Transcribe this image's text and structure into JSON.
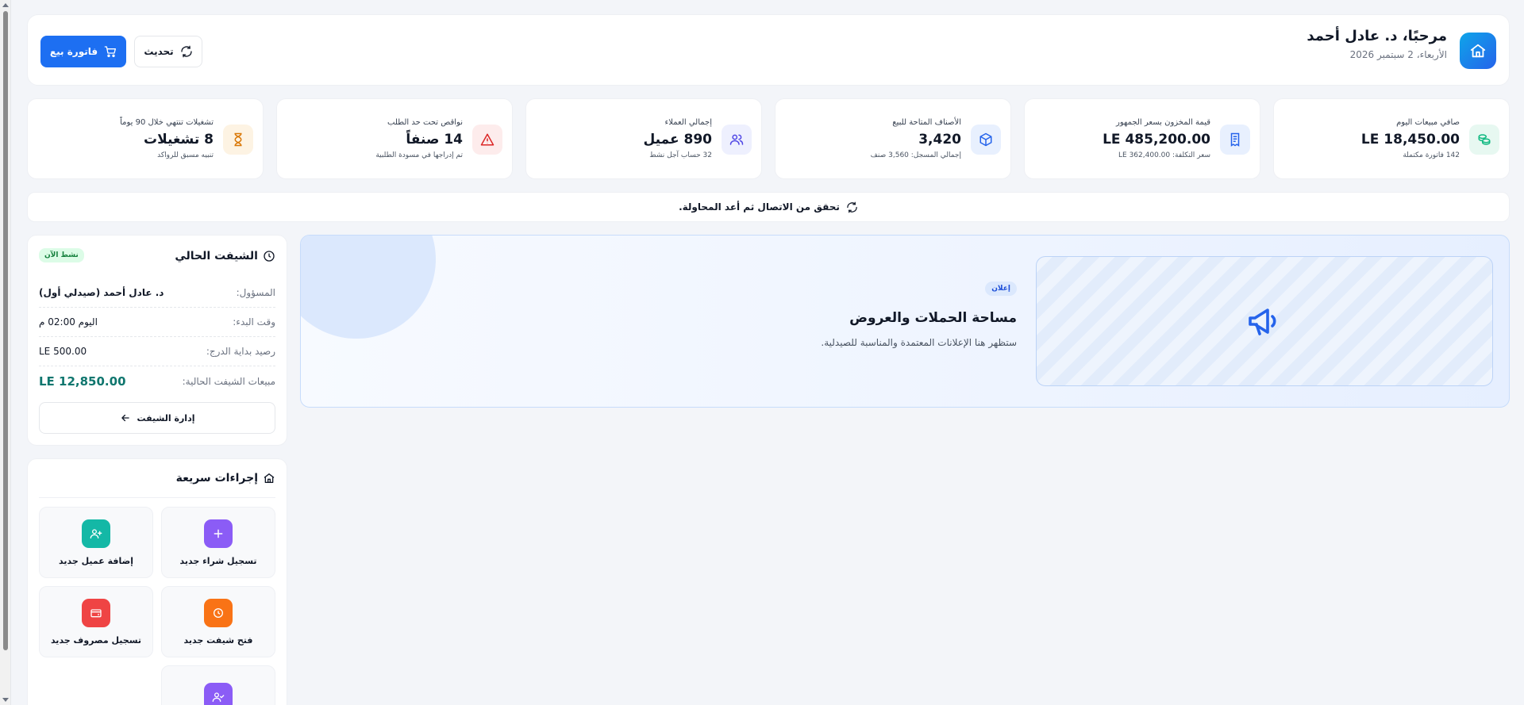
{
  "header": {
    "greeting": "مرحبًا، د. عادل أحمد",
    "date": "الأربعاء، 2 سبتمبر 2026",
    "invoice_button": "فاتورة بيع",
    "refresh_button": "تحديث"
  },
  "stats": [
    {
      "label": "صافي مبيعات اليوم",
      "value": "18,450.00 LE",
      "sub": "142 فاتورة مكتملة",
      "icon": "coins-icon",
      "color": "#10b981",
      "bg": "#e7f8f1"
    },
    {
      "label": "قيمة المخزون بسعر الجمهور",
      "value": "485,200.00 LE",
      "sub": "سعر التكلفة: 362,400.00 LE",
      "icon": "receipt-icon",
      "color": "#2563eb",
      "bg": "#e8f0fe"
    },
    {
      "label": "الأصناف المتاحة للبيع",
      "value": "3,420",
      "sub": "إجمالي المسجل: 3,560 صنف",
      "icon": "box-icon",
      "color": "#2563eb",
      "bg": "#e8f0fe"
    },
    {
      "label": "إجمالي العملاء",
      "value": "890 عميل",
      "sub": "32 حساب آجل نشط",
      "icon": "users-icon",
      "color": "#4f46e5",
      "bg": "#eef0fe"
    },
    {
      "label": "نواقص تحت حد الطلب",
      "value": "14 صنفاً",
      "sub": "تم إدراجها في مسودة الطلبية",
      "icon": "warning-icon",
      "color": "#dc2626",
      "bg": "#fdecec"
    },
    {
      "label": "تشغيلات تنتهي خلال 90 يوماً",
      "value": "8 تشغيلات",
      "sub": "تنبيه مسبق للرواكد",
      "icon": "hourglass-icon",
      "color": "#d97706",
      "bg": "#fdf3e3"
    }
  ],
  "connection": {
    "message": "تحقق من الاتصال ثم أعد المحاولة."
  },
  "ad": {
    "badge": "إعلان",
    "title": "مساحة الحملات والعروض",
    "description": "ستظهر هنا الإعلانات المعتمدة والمناسبة للصيدلية."
  },
  "shift": {
    "title": "الشيفت الحالي",
    "status": "نشط الآن",
    "rows": [
      {
        "key": "المسؤول:",
        "value": "د. عادل أحمد (صيدلي أول)"
      },
      {
        "key": "وقت البدء:",
        "value": "اليوم 02:00 م"
      },
      {
        "key": "رصيد بداية الدرج:",
        "value": "500.00 LE"
      },
      {
        "key": "مبيعات الشيفت الحالية:",
        "value": "12,850.00 LE"
      }
    ],
    "manage_button": "إدارة الشيفت"
  },
  "quick_actions": {
    "title": "إجراءات سريعة",
    "items": [
      {
        "label": "تسجيل شراء جديد",
        "icon": "plus-icon",
        "color": "#8b5cf6"
      },
      {
        "label": "إضافة عميل جديد",
        "icon": "user-plus-icon",
        "color": "#14b8a6"
      },
      {
        "label": "فتح شيفت جديد",
        "icon": "clock-icon",
        "color": "#f97316"
      },
      {
        "label": "تسجيل مصروف جديد",
        "icon": "wallet-icon",
        "color": "#ef4444"
      },
      {
        "label": "",
        "icon": "user-check-icon",
        "color": "#8b5cf6"
      }
    ]
  }
}
